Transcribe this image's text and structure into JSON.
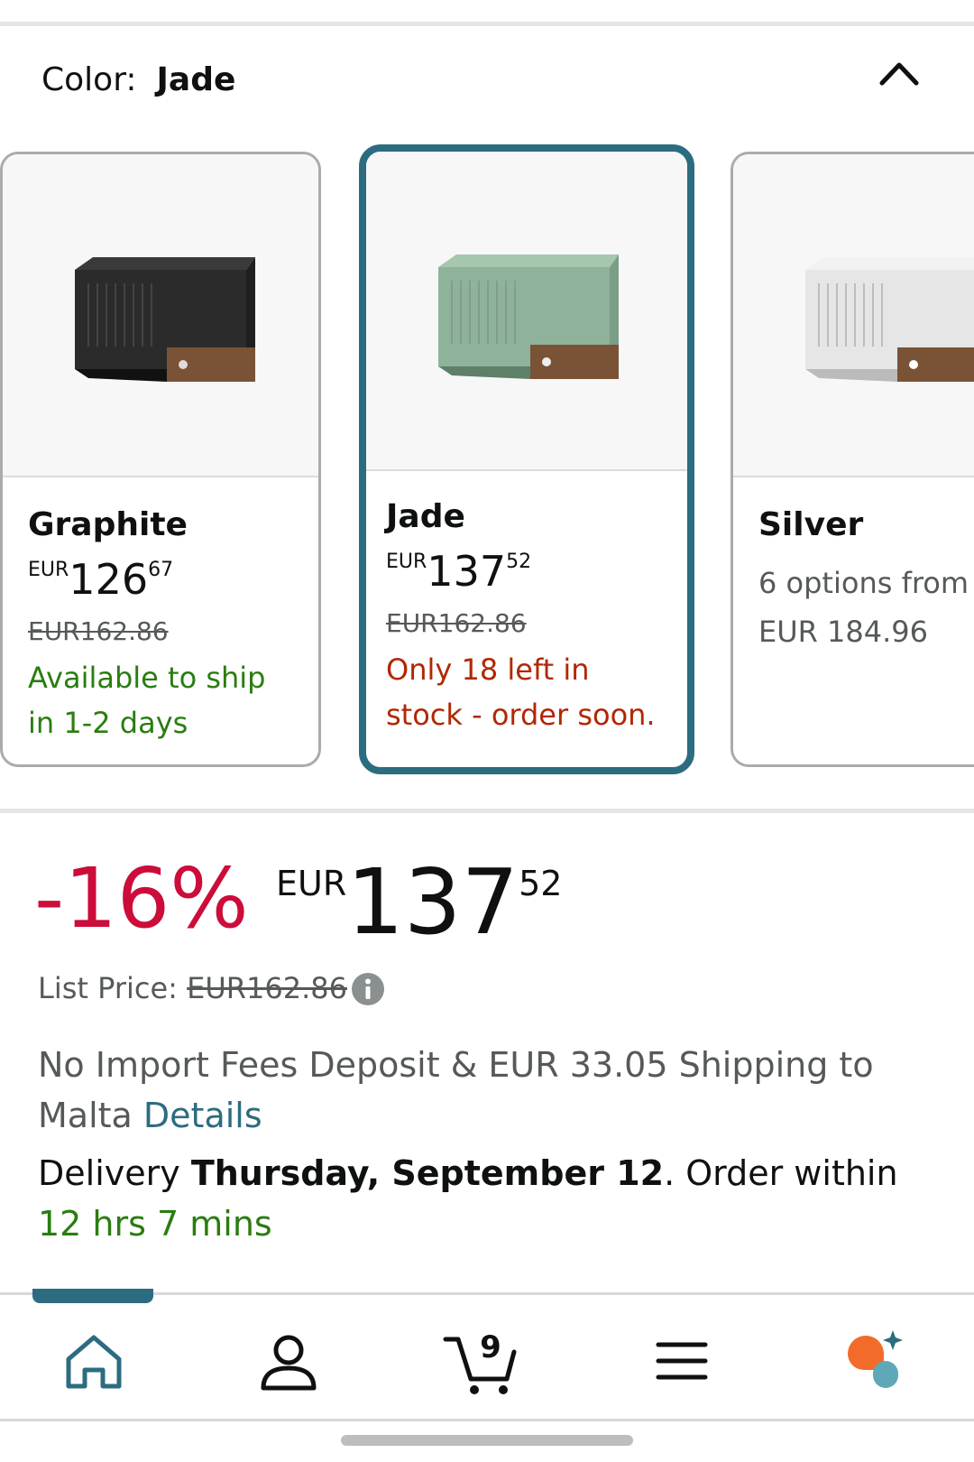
{
  "variation": {
    "label": "Color:",
    "selected": "Jade"
  },
  "cards": [
    {
      "name": "Graphite",
      "currency": "EUR",
      "price_whole": "126",
      "price_cents": "67",
      "list_price": "EUR162.86",
      "availability_line1": "Available to ship",
      "availability_line2": "in 1-2 days"
    },
    {
      "name": "Jade",
      "currency": "EUR",
      "price_whole": "137",
      "price_cents": "52",
      "list_price": "EUR162.86",
      "availability_line1": "Only 18 left in",
      "availability_line2": "stock - order soon."
    },
    {
      "name": "Silver",
      "options_line1": "6 options from",
      "options_line2": "EUR 184.96"
    }
  ],
  "price_block": {
    "discount": "-16%",
    "currency": "EUR",
    "whole": "137",
    "cents": "52",
    "list_label": "List Price:",
    "list_value": "EUR162.86"
  },
  "shipping": {
    "text_line1": "No Import Fees Deposit & EUR 33.05 Shipping to",
    "text_line2": "Malta",
    "details_link": "Details"
  },
  "delivery": {
    "prefix": "Delivery",
    "date": "Thursday, September 12",
    "order_within": ". Order within",
    "countdown": "12 hrs 7 mins"
  },
  "bottom_nav": {
    "cart_count": "9",
    "items": [
      "home-icon",
      "account-icon",
      "cart-icon",
      "menu-icon",
      "assistant-icon"
    ]
  },
  "colors": {
    "accent": "#2c6c80",
    "discount_red": "#cc0c39",
    "stock_red": "#b12704",
    "green": "#2a7d10"
  }
}
